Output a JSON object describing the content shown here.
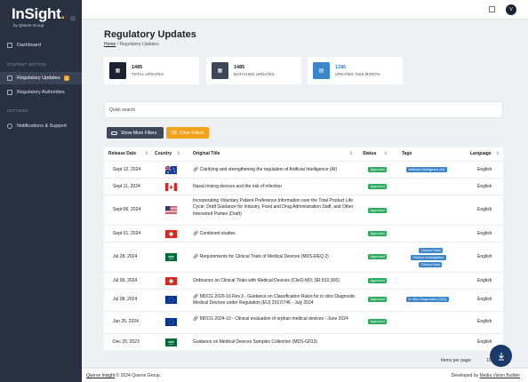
{
  "sidebar": {
    "logo_main": "InSight",
    "logo_dot": ".",
    "logo_sub": "by Qserve Group",
    "dashboard": "Dashboard",
    "section_content": "CONTENT SECTION",
    "regulatory_updates": "Regulatory Updates",
    "regulatory_updates_badge": "9",
    "regulatory_authorities": "Regulatory Authorities",
    "section_settings": "SETTINGS",
    "notifications_support": "Notifications & Support"
  },
  "topbar": {
    "avatar_initial": "V"
  },
  "page": {
    "title": "Regulatory Updates",
    "breadcrumb_home": "Home",
    "breadcrumb_sep": "/",
    "breadcrumb_current": "Regulatory Updates"
  },
  "stats": [
    {
      "value": "1485",
      "label": "TOTAL UPDATES",
      "color": "#1c2433"
    },
    {
      "value": "1485",
      "label": "MATCHING UPDATES",
      "color": "#3e4757"
    },
    {
      "value": "1286",
      "label": "UPDATES THIS MONTH",
      "color": "#3a86c9"
    }
  ],
  "search": {
    "placeholder": "Quick search"
  },
  "buttons": {
    "more_filters": "Show More Filters",
    "clear_filters": "Clear Filters"
  },
  "table": {
    "headers": {
      "release_date": "Release Date",
      "country": "Country",
      "original_title": "Original Title",
      "status": "Status",
      "tags": "Tags",
      "language": "Language"
    },
    "rows": [
      {
        "date": "Sept 12, 2024",
        "flag": "australia",
        "title": "Clarifying and strengthening the regulation of Artificial Intelligence (AI)",
        "link": true,
        "status": "Approved",
        "tags": [
          "Artificial Intelligence (AI)"
        ],
        "language": "English"
      },
      {
        "date": "Sept 11, 2024",
        "flag": "canada",
        "title": "Nasal rinsing devices and the risk of infection",
        "link": false,
        "status": "Approved",
        "tags": [],
        "language": "English"
      },
      {
        "date": "Sept 06, 2024",
        "flag": "usa",
        "title": "Incorporating Voluntary Patient Preference Information over the Total Product Life Cycle; Draft Guidance for Industry, Food and Drug Administration Staff, and Other Interested Parties (Draft)",
        "link": false,
        "status": "Approved",
        "tags": [],
        "language": "English"
      },
      {
        "date": "Sept 01, 2024",
        "flag": "switzerland",
        "title": "Combined studies",
        "link": true,
        "status": "Approved",
        "tags": [],
        "language": "English"
      },
      {
        "date": "Jul 28, 2024",
        "flag": "saudi",
        "title": "Requirements for Clinical Trials of Medical Devices (MDS-REQ 2)",
        "link": true,
        "status": "Approved",
        "tags": [
          "Clinical Trials",
          "Clinical Investigation",
          "Clinical Data"
        ],
        "language": "English"
      },
      {
        "date": "Jul 09, 2024",
        "flag": "switzerland",
        "title": "Ordinance on Clinical Trials with Medical Devices (ClinO-MD; SR 810.306)",
        "link": false,
        "status": "Approved",
        "tags": [],
        "language": "English"
      },
      {
        "date": "Jul 08, 2024",
        "flag": "eu",
        "title": "MDCG 2020-16 Rev.3 - Guidance on Classification Rules for in vitro Diagnostic Medical Devices under Regulation (EU) 2017/746 - July 2024",
        "link": true,
        "status": "Approved",
        "tags": [
          "In Vitro Diagnostics (IVD)"
        ],
        "language": "English"
      },
      {
        "date": "Jun 25, 2024",
        "flag": "eu",
        "title": "MDCG 2024-10 - Clinical evaluation of orphan medical devices - June 2024",
        "link": true,
        "status": "Approved",
        "tags": [],
        "language": "English"
      },
      {
        "date": "Dec 20, 2023",
        "flag": "saudi",
        "title": "Guidance on Medical Devices Samples Collection (MDS-G013)",
        "link": false,
        "status": "Approved",
        "tags": [],
        "language": "English"
      }
    ]
  },
  "pagination": {
    "items_per_page_label": "Items per page:",
    "items_per_page_value": "10"
  },
  "footer": {
    "left_link": "Qserve Insight",
    "left_text": "© 2024 Qserve Group.",
    "right_text": "Developed by",
    "right_link": "Media Vision Builder"
  }
}
